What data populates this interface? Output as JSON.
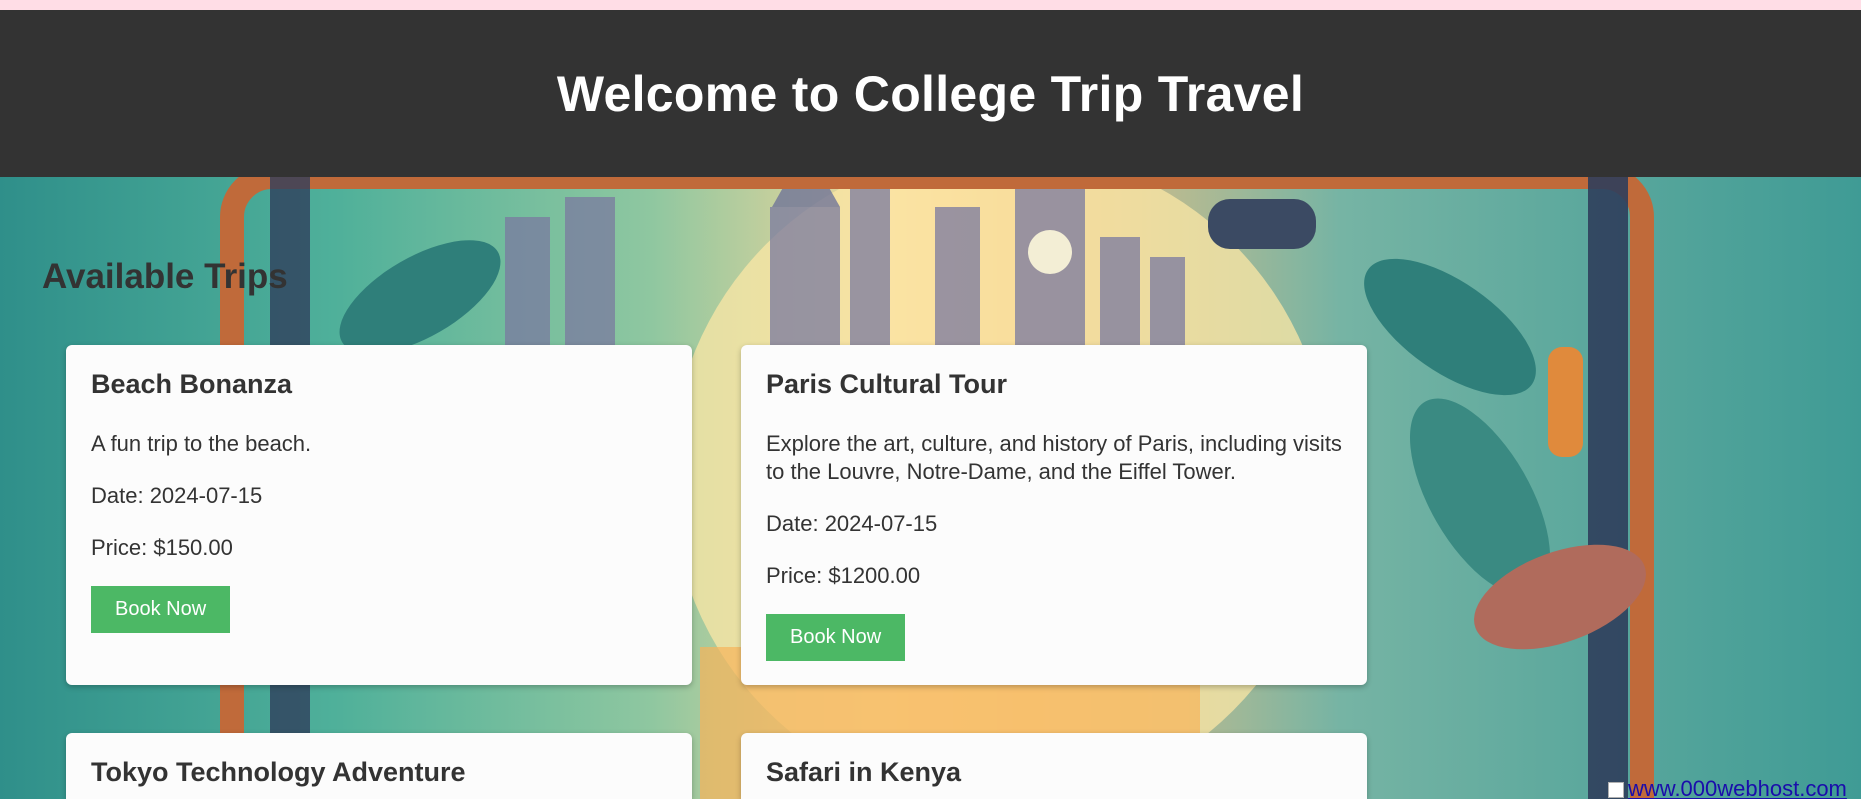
{
  "header": {
    "title": "Welcome to College Trip Travel"
  },
  "main": {
    "section_title": "Available Trips",
    "trips": [
      {
        "title": "Beach Bonanza",
        "description": "A fun trip to the beach.",
        "date": "Date: 2024-07-15",
        "price": "Price: $150.00",
        "button_label": "Book Now"
      },
      {
        "title": "Paris Cultural Tour",
        "description": "Explore the art, culture, and history of Paris, including visits to the Louvre, Notre-Dame, and the Eiffel Tower.",
        "date": "Date: 2024-07-15",
        "price": "Price: $1200.00",
        "button_label": "Book Now"
      },
      {
        "title": "Tokyo Technology Adventure"
      },
      {
        "title": "Safari in Kenya"
      }
    ]
  },
  "footer": {
    "host_link": "www.000webhost.com"
  },
  "colors": {
    "header_bg": "#333333",
    "button_bg": "#4cb865",
    "card_bg": "#fcfcfc",
    "link": "#1a0dab"
  }
}
